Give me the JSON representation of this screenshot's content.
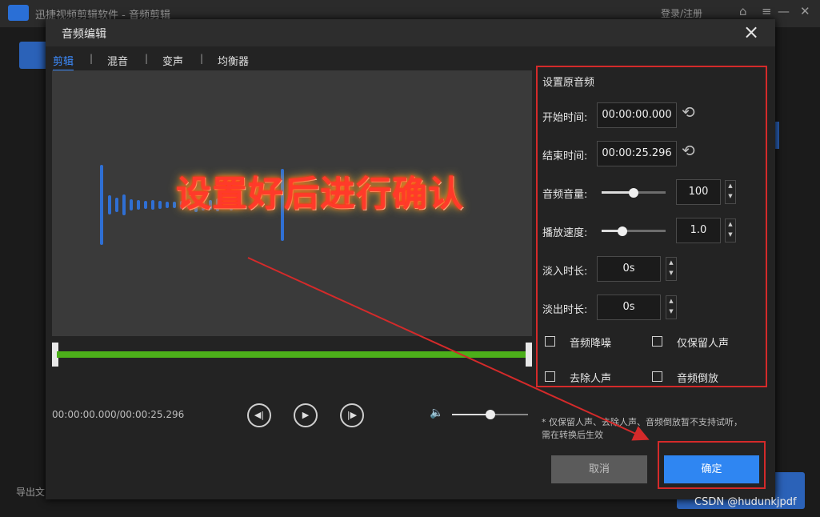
{
  "app": {
    "title": "迅捷视频剪辑软件 - 音频剪辑",
    "login": "登录/注册",
    "export_label": "导出文"
  },
  "dialog": {
    "title": "音频编辑",
    "tabs": [
      {
        "label": "剪辑",
        "active": true
      },
      {
        "label": "混音",
        "active": false
      },
      {
        "label": "变声",
        "active": false
      },
      {
        "label": "均衡器",
        "active": false
      }
    ],
    "player": {
      "time": "00:00:00.000/00:00:25.296",
      "volume_level": 0.5
    },
    "annotation": "设置好后进行确认",
    "panel": {
      "title": "设置原音频",
      "start_label": "开始时间:",
      "start_value": "00:00:00.000",
      "end_label": "结束时间:",
      "end_value": "00:00:25.296",
      "volume_label": "音频音量:",
      "volume_value": "100",
      "volume_slider": 0.5,
      "speed_label": "播放速度:",
      "speed_value": "1.0",
      "speed_slider": 0.33,
      "fadein_label": "淡入时长:",
      "fadein_value": "0s",
      "fadeout_label": "淡出时长:",
      "fadeout_value": "0s",
      "checkboxes": [
        {
          "label": "音频降噪",
          "checked": false
        },
        {
          "label": "仅保留人声",
          "checked": false
        },
        {
          "label": "去除人声",
          "checked": false
        },
        {
          "label": "音频倒放",
          "checked": false
        }
      ]
    },
    "note": "* 仅保留人声、去除人声、音频倒放暂不支持试听，需在转换后生效",
    "cancel_label": "取消",
    "ok_label": "确定"
  },
  "watermark": "CSDN @hudunkjpdf",
  "colors": {
    "accent": "#2f86f2",
    "highlight": "#d42a2a",
    "timeline": "#4caf1a"
  }
}
